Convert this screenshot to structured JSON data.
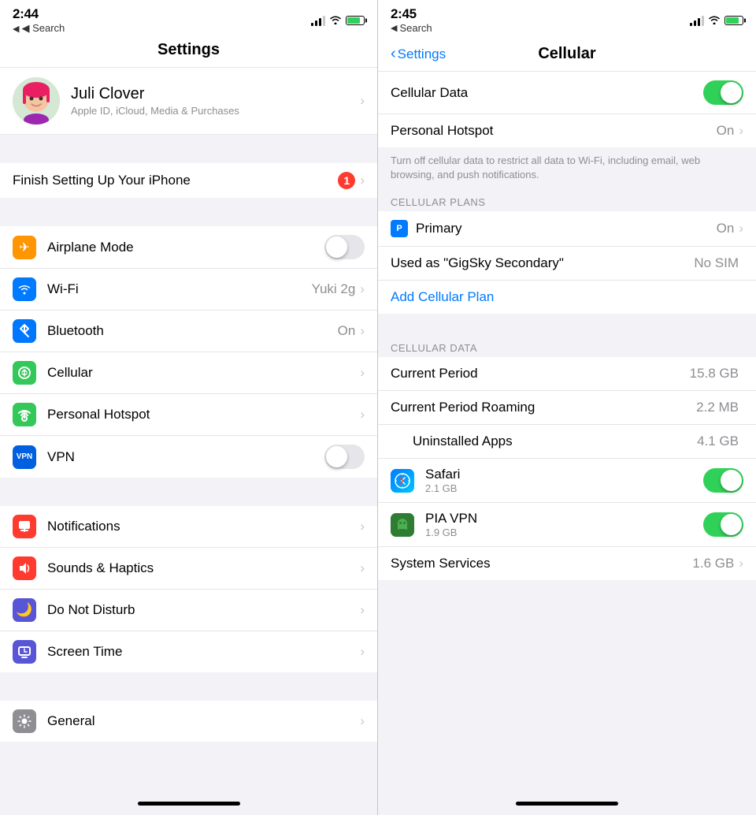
{
  "left": {
    "status": {
      "time": "2:44",
      "navigation_arrow": "▶",
      "back_label": "◀ Search"
    },
    "nav_title": "Settings",
    "profile": {
      "name": "Juli Clover",
      "subtitle": "Apple ID, iCloud, Media & Purchases"
    },
    "finish_setup": "Finish Setting Up Your iPhone",
    "finish_badge": "1",
    "settings": [
      {
        "id": "airplane",
        "label": "Airplane Mode",
        "icon": "✈",
        "icon_color": "icon-orange",
        "type": "toggle",
        "value": "off"
      },
      {
        "id": "wifi",
        "label": "Wi-Fi",
        "icon": "",
        "icon_color": "icon-blue",
        "type": "chevron",
        "value": "Yuki 2g"
      },
      {
        "id": "bluetooth",
        "label": "Bluetooth",
        "icon": "",
        "icon_color": "icon-blue-bt",
        "type": "chevron",
        "value": "On"
      },
      {
        "id": "cellular",
        "label": "Cellular",
        "icon": "",
        "icon_color": "icon-green",
        "type": "chevron",
        "value": ""
      },
      {
        "id": "hotspot",
        "label": "Personal Hotspot",
        "icon": "",
        "icon_color": "icon-green-hotspot",
        "type": "chevron",
        "value": ""
      },
      {
        "id": "vpn",
        "label": "VPN",
        "icon": "VPN",
        "icon_color": "icon-blue-vpn",
        "type": "toggle",
        "value": "off"
      }
    ],
    "settings2": [
      {
        "id": "notifications",
        "label": "Notifications",
        "icon": "",
        "icon_color": "icon-red-notif",
        "type": "chevron",
        "value": ""
      },
      {
        "id": "sounds",
        "label": "Sounds & Haptics",
        "icon": "",
        "icon_color": "icon-red-sounds",
        "type": "chevron",
        "value": ""
      },
      {
        "id": "donotdisturb",
        "label": "Do Not Disturb",
        "icon": "🌙",
        "icon_color": "icon-purple",
        "type": "chevron",
        "value": ""
      },
      {
        "id": "screentime",
        "label": "Screen Time",
        "icon": "",
        "icon_color": "icon-purple-screen",
        "type": "chevron",
        "value": ""
      }
    ],
    "settings3": [
      {
        "id": "general",
        "label": "General",
        "icon": "⚙",
        "icon_color": "icon-gray",
        "type": "chevron",
        "value": ""
      }
    ]
  },
  "right": {
    "status": {
      "time": "2:45",
      "navigation_arrow": "▶",
      "back_label": "◀ Search"
    },
    "nav_back": "Settings",
    "nav_title": "Cellular",
    "cellular_data_label": "Cellular Data",
    "cellular_data_on": true,
    "personal_hotspot_label": "Personal Hotspot",
    "personal_hotspot_value": "On",
    "info_text": "Turn off cellular data to restrict all data to Wi-Fi, including email, web browsing, and push notifications.",
    "cellular_plans_section": "CELLULAR PLANS",
    "primary_label": "Primary",
    "primary_icon": "P",
    "primary_value": "On",
    "used_as_label": "Used as \"GigSky Secondary\"",
    "used_as_value": "No SIM",
    "add_plan_label": "Add Cellular Plan",
    "cellular_data_section": "CELLULAR DATA",
    "current_period_label": "Current Period",
    "current_period_value": "15.8 GB",
    "current_period_roaming_label": "Current Period Roaming",
    "current_period_roaming_value": "2.2 MB",
    "uninstalled_apps_label": "Uninstalled Apps",
    "uninstalled_apps_value": "4.1 GB",
    "safari_name": "Safari",
    "safari_size": "2.1 GB",
    "safari_toggle": true,
    "pia_vpn_name": "PIA VPN",
    "pia_vpn_size": "1.9 GB",
    "pia_vpn_toggle": true,
    "system_services_label": "System Services",
    "system_services_value": "1.6 GB"
  }
}
